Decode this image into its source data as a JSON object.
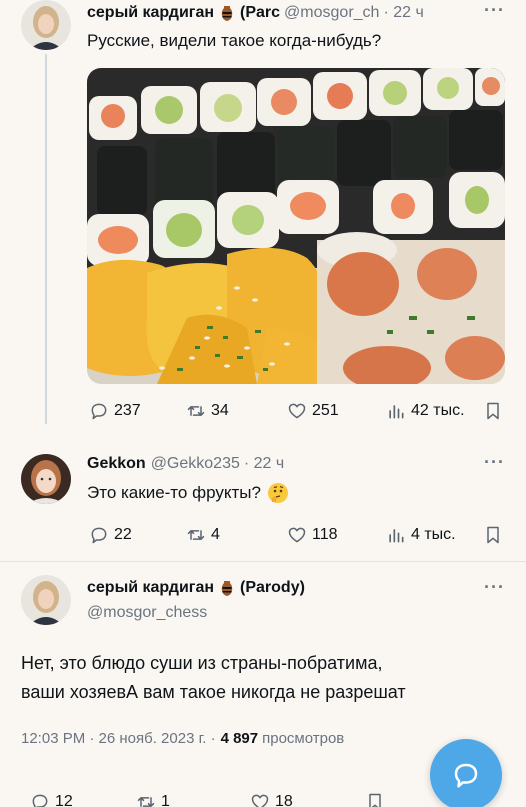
{
  "tweet1": {
    "name": "серый кардиган",
    "badge_icon": "amphora-emoji",
    "name_suffix": "(Parc",
    "handle": "@mosgor_ch",
    "time": "· 22 ч",
    "text": "Русские, видели такое когда-нибудь?",
    "stats": {
      "replies": "237",
      "retweets": "34",
      "likes": "251",
      "views": "42 тыс."
    }
  },
  "tweet2": {
    "name": "Gekkon",
    "handle": "@Gekko235",
    "time": "· 22 ч",
    "text": "Это какие-то фрукты?",
    "emoji_icon": "thinking-face-emoji",
    "stats": {
      "replies": "22",
      "retweets": "4",
      "likes": "118",
      "views": "4 тыс."
    }
  },
  "main_tweet": {
    "name": "серый кардиган",
    "badge_icon": "amphora-emoji",
    "name_suffix": "(Parody)",
    "handle": "@mosgor_chess",
    "text_line1": "Нет, это блюдо суши из страны-побратима,",
    "text_line2": "ваши хозяевА вам такое никогда не разрешат",
    "timestamp": "12:03 PM · 26 нояб. 2023 г. ·",
    "views_count": "4 897",
    "views_label": "просмотров",
    "stats": {
      "replies": "12",
      "retweets": "1",
      "likes": "18"
    }
  },
  "more_label": "···",
  "colors": {
    "accent": "#4ea8e8",
    "muted": "#6b7480",
    "background": "#faf7f3"
  }
}
